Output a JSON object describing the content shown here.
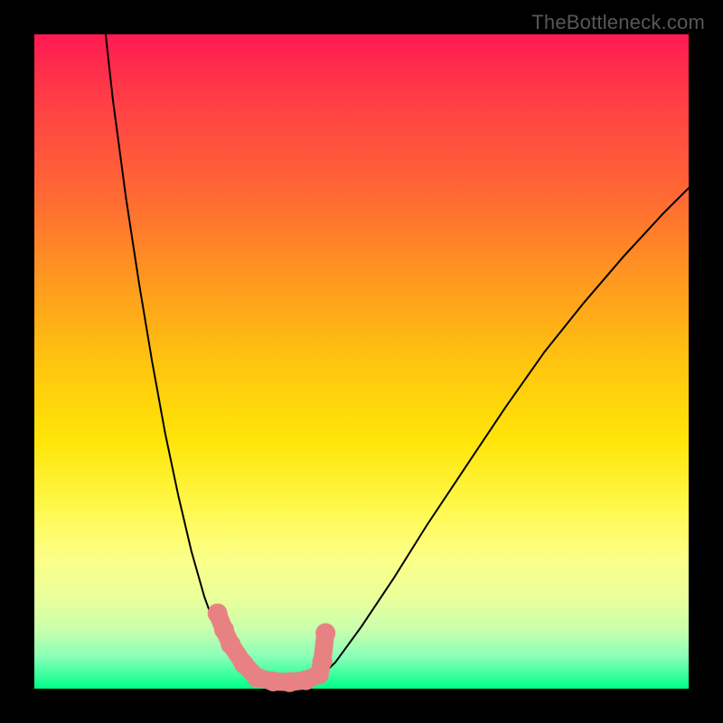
{
  "watermark": "TheBottleneck.com",
  "chart_data": {
    "type": "line",
    "title": "",
    "xlabel": "",
    "ylabel": "",
    "xlim": [
      0,
      100
    ],
    "ylim": [
      0,
      100
    ],
    "series": [
      {
        "name": "curve-left",
        "x": [
          10.9,
          12,
          14,
          16,
          18,
          20,
          22,
          24,
          26,
          28,
          29.5,
          31,
          32.5,
          34
        ],
        "values": [
          100,
          90,
          75,
          62,
          50,
          39,
          29.5,
          21,
          14,
          8.5,
          5.5,
          3.4,
          1.8,
          0.9
        ]
      },
      {
        "name": "valley-flat",
        "x": [
          34,
          37,
          40,
          43
        ],
        "values": [
          0.9,
          0.6,
          0.6,
          1.2
        ]
      },
      {
        "name": "curve-right",
        "x": [
          43,
          46,
          50,
          55,
          60,
          66,
          72,
          78,
          84,
          90,
          96,
          100
        ],
        "values": [
          1.2,
          4,
          9.5,
          17,
          25,
          34,
          43,
          51.5,
          59,
          66,
          72.5,
          76.5
        ]
      }
    ],
    "markers": {
      "name": "highlight-dots",
      "x": [
        28.0,
        29.0,
        30.0,
        32.0,
        34.0,
        36.5,
        39.0,
        41.5,
        43.5,
        44.0,
        44.5
      ],
      "values": [
        11.5,
        9.0,
        6.8,
        3.8,
        1.7,
        1.1,
        1.0,
        1.3,
        2.2,
        4.2,
        8.5
      ]
    },
    "gradient_stops": [
      {
        "pos": 0,
        "color": "#ff1a52"
      },
      {
        "pos": 50,
        "color": "#ffc40f"
      },
      {
        "pos": 80,
        "color": "#fcff88"
      },
      {
        "pos": 100,
        "color": "#00ff88"
      }
    ]
  }
}
